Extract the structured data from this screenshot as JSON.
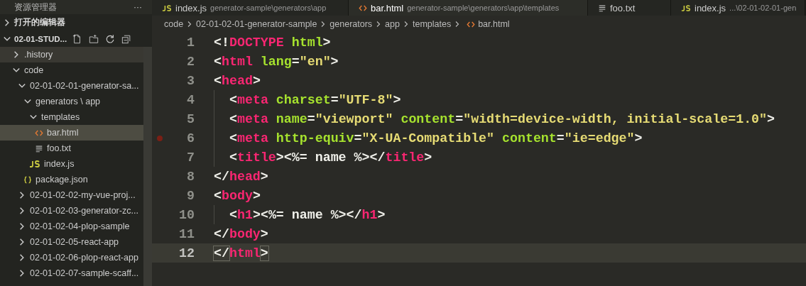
{
  "sidebar": {
    "title": "资源管理器",
    "more": "···",
    "sections": [
      {
        "label": "打开的编辑器",
        "expanded": false
      },
      {
        "label": "02-01-STUD...",
        "expanded": true
      }
    ],
    "tree": [
      {
        "label": ".history",
        "kind": "folder",
        "expanded": false,
        "selected": false,
        "hovered": true
      },
      {
        "label": "code",
        "kind": "folder",
        "expanded": true,
        "selected": false,
        "hovered": false,
        "children": [
          {
            "label": "02-01-02-01-generator-sa...",
            "kind": "folder",
            "expanded": true,
            "selected": false,
            "hovered": false,
            "children": [
              {
                "label": "generators \\ app",
                "kind": "folder",
                "expanded": true,
                "selected": false,
                "hovered": false,
                "children": [
                  {
                    "label": "templates",
                    "kind": "folder",
                    "expanded": true,
                    "selected": false,
                    "hovered": false,
                    "children": [
                      {
                        "label": "bar.html",
                        "kind": "html",
                        "selected": true,
                        "hovered": false
                      },
                      {
                        "label": "foo.txt",
                        "kind": "txt",
                        "selected": false,
                        "hovered": false
                      }
                    ]
                  },
                  {
                    "label": "index.js",
                    "kind": "js",
                    "selected": false,
                    "hovered": false
                  }
                ]
              },
              {
                "label": "package.json",
                "kind": "json",
                "selected": false,
                "hovered": false
              }
            ]
          },
          {
            "label": "02-01-02-02-my-vue-proj...",
            "kind": "folder",
            "expanded": false,
            "selected": false,
            "hovered": false
          },
          {
            "label": "02-01-02-03-generator-zc...",
            "kind": "folder",
            "expanded": false,
            "selected": false,
            "hovered": false
          },
          {
            "label": "02-01-02-04-plop-sample",
            "kind": "folder",
            "expanded": false,
            "selected": false,
            "hovered": false
          },
          {
            "label": "02-01-02-05-react-app",
            "kind": "folder",
            "expanded": false,
            "selected": false,
            "hovered": false
          },
          {
            "label": "02-01-02-06-plop-react-app",
            "kind": "folder",
            "expanded": false,
            "selected": false,
            "hovered": false
          },
          {
            "label": "02-01-02-07-sample-scaff...",
            "kind": "folder",
            "expanded": false,
            "selected": false,
            "hovered": false
          }
        ]
      }
    ]
  },
  "tabs": [
    {
      "label": "index.js",
      "description": "generator-sample\\generators\\app",
      "kind": "js",
      "selected": false
    },
    {
      "label": "bar.html",
      "description": "generator-sample\\generators\\app\\templates",
      "kind": "html",
      "selected": true
    },
    {
      "label": "foo.txt",
      "kind": "txt",
      "selected": false
    },
    {
      "label": "index.js",
      "description": "...\\02-01-02-01-gen",
      "kind": "js",
      "selected": false
    }
  ],
  "breadcrumb": [
    {
      "label": "code",
      "kind": "text"
    },
    {
      "label": "02-01-02-01-generator-sample",
      "kind": "text"
    },
    {
      "label": "generators",
      "kind": "text"
    },
    {
      "label": "app",
      "kind": "text"
    },
    {
      "label": "templates",
      "kind": "text"
    },
    {
      "label": "bar.html",
      "kind": "html"
    }
  ],
  "code": [
    {
      "number": "1",
      "indented": false,
      "breakpoint": false,
      "current": false,
      "tokens": [
        {
          "kind": "punct",
          "text": "<!"
        },
        {
          "kind": "tag",
          "text": "DOCTYPE"
        },
        {
          "kind": "attr",
          "text": " html"
        },
        {
          "kind": "punct",
          "text": ">"
        }
      ]
    },
    {
      "number": "2",
      "indented": false,
      "breakpoint": false,
      "current": false,
      "tokens": [
        {
          "kind": "punct",
          "text": "<"
        },
        {
          "kind": "tag",
          "text": "html"
        },
        {
          "kind": "attr",
          "text": " lang"
        },
        {
          "kind": "punct",
          "text": "="
        },
        {
          "kind": "string",
          "text": "\"en\""
        },
        {
          "kind": "punct",
          "text": ">"
        }
      ]
    },
    {
      "number": "3",
      "indented": false,
      "breakpoint": false,
      "current": false,
      "tokens": [
        {
          "kind": "punct",
          "text": "<"
        },
        {
          "kind": "tag",
          "text": "head"
        },
        {
          "kind": "punct",
          "text": ">"
        }
      ]
    },
    {
      "number": "4",
      "indented": true,
      "breakpoint": false,
      "current": false,
      "tokens": [
        {
          "kind": "punct",
          "text": "<"
        },
        {
          "kind": "tag",
          "text": "meta"
        },
        {
          "kind": "attr",
          "text": " charset"
        },
        {
          "kind": "punct",
          "text": "="
        },
        {
          "kind": "string",
          "text": "\"UTF-8\""
        },
        {
          "kind": "punct",
          "text": ">"
        }
      ]
    },
    {
      "number": "5",
      "indented": true,
      "breakpoint": false,
      "current": false,
      "tokens": [
        {
          "kind": "punct",
          "text": "<"
        },
        {
          "kind": "tag",
          "text": "meta"
        },
        {
          "kind": "attr",
          "text": " name"
        },
        {
          "kind": "punct",
          "text": "="
        },
        {
          "kind": "string",
          "text": "\"viewport\""
        },
        {
          "kind": "attr",
          "text": " content"
        },
        {
          "kind": "punct",
          "text": "="
        },
        {
          "kind": "string",
          "text": "\"width=device-width, initial-scale=1.0\""
        },
        {
          "kind": "punct",
          "text": ">"
        }
      ]
    },
    {
      "number": "6",
      "indented": true,
      "breakpoint": true,
      "current": false,
      "tokens": [
        {
          "kind": "punct",
          "text": "<"
        },
        {
          "kind": "tag",
          "text": "meta"
        },
        {
          "kind": "attr",
          "text": " http-equiv"
        },
        {
          "kind": "punct",
          "text": "="
        },
        {
          "kind": "string",
          "text": "\"X-UA-Compatible\""
        },
        {
          "kind": "attr",
          "text": " content"
        },
        {
          "kind": "punct",
          "text": "="
        },
        {
          "kind": "string",
          "text": "\"ie=edge\""
        },
        {
          "kind": "punct",
          "text": ">"
        }
      ]
    },
    {
      "number": "7",
      "indented": true,
      "breakpoint": false,
      "current": false,
      "tokens": [
        {
          "kind": "punct",
          "text": "<"
        },
        {
          "kind": "tag",
          "text": "title"
        },
        {
          "kind": "punct",
          "text": "><%= name %></"
        },
        {
          "kind": "tag",
          "text": "title"
        },
        {
          "kind": "punct",
          "text": ">"
        }
      ]
    },
    {
      "number": "8",
      "indented": false,
      "breakpoint": false,
      "current": false,
      "tokens": [
        {
          "kind": "punct",
          "text": "</"
        },
        {
          "kind": "tag",
          "text": "head"
        },
        {
          "kind": "punct",
          "text": ">"
        }
      ]
    },
    {
      "number": "9",
      "indented": false,
      "breakpoint": false,
      "current": false,
      "tokens": [
        {
          "kind": "punct",
          "text": "<"
        },
        {
          "kind": "tag",
          "text": "body"
        },
        {
          "kind": "punct",
          "text": ">"
        }
      ]
    },
    {
      "number": "10",
      "indented": true,
      "breakpoint": false,
      "current": false,
      "tokens": [
        {
          "kind": "punct",
          "text": "<"
        },
        {
          "kind": "tag",
          "text": "h1"
        },
        {
          "kind": "punct",
          "text": "><%= name %></"
        },
        {
          "kind": "tag",
          "text": "h1"
        },
        {
          "kind": "punct",
          "text": ">"
        }
      ]
    },
    {
      "number": "11",
      "indented": false,
      "breakpoint": false,
      "current": false,
      "tokens": [
        {
          "kind": "punct",
          "text": "</"
        },
        {
          "kind": "tag",
          "text": "body"
        },
        {
          "kind": "punct",
          "text": ">"
        }
      ]
    },
    {
      "number": "12",
      "indented": false,
      "breakpoint": false,
      "current": true,
      "tokens": [
        {
          "kind": "punct",
          "text": "</"
        },
        {
          "kind": "tag",
          "text": "html"
        },
        {
          "kind": "punct",
          "text": ">"
        }
      ]
    }
  ]
}
